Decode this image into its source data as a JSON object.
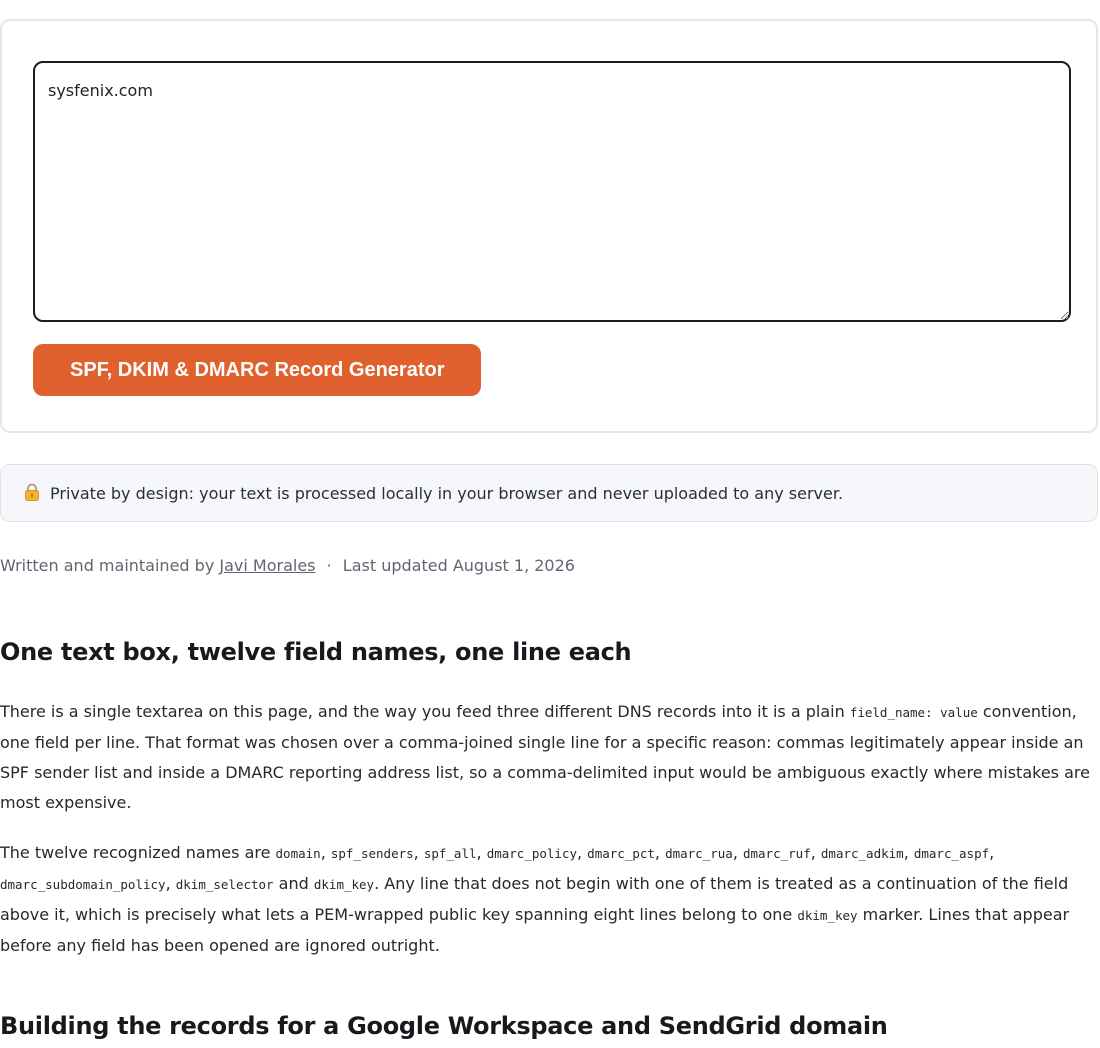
{
  "tool": {
    "input_value": "sysfenix.com",
    "button_label": "SPF, DKIM & DMARC Record Generator"
  },
  "privacy": {
    "icon": "lock-icon",
    "text": "Private by design: your text is processed locally in your browser and never uploaded to any server."
  },
  "byline": {
    "prefix": "Written and maintained by",
    "author": "Javi Morales",
    "separator": "·",
    "updated": "Last updated August 1, 2026"
  },
  "article": {
    "heading_one": "One text box, twelve field names, one line each",
    "para_one": {
      "t1": "There is a single textarea on this page, and the way you feed three different DNS records into it is a plain ",
      "code1": "field_name: value",
      "t2": " convention, one field per line. That format was chosen over a comma-joined single line for a specific reason: commas legitimately appear inside an SPF sender list and inside a DMARC reporting address list, so a comma-delimited input would be ambiguous exactly where mistakes are most expensive."
    },
    "para_two": {
      "t1": "The twelve recognized names are ",
      "fields": [
        "domain",
        "spf_senders",
        "spf_all",
        "dmarc_policy",
        "dmarc_pct",
        "dmarc_rua",
        "dmarc_ruf",
        "dmarc_adkim",
        "dmarc_aspf",
        "dmarc_subdomain_policy",
        "dkim_selector",
        "dkim_key"
      ],
      "comma": ", ",
      "and": " and ",
      "t2": ". Any line that does not begin with one of them is treated as a continuation of the field above it, which is precisely what lets a PEM-wrapped public key spanning eight lines belong to one ",
      "code_marker": "dkim_key",
      "t3": " marker. Lines that appear before any field has been opened are ignored outright."
    },
    "heading_two": "Building the records for a Google Workspace and SendGrid domain"
  },
  "colors": {
    "accent": "#e0602e",
    "card_border": "#e3e6ea",
    "note_background": "#f5f7fa"
  }
}
